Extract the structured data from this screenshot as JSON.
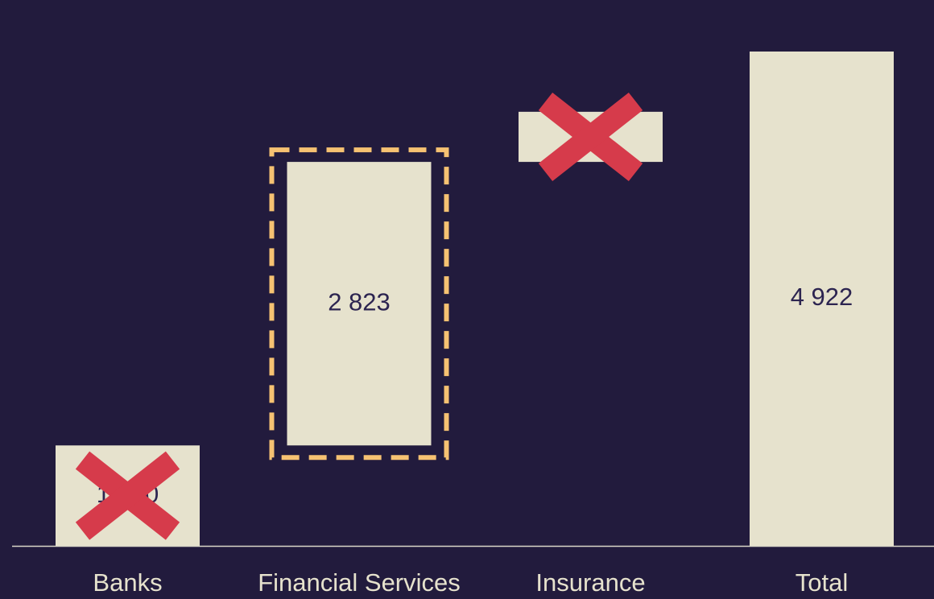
{
  "chart_data": {
    "type": "bar",
    "subtype": "waterfall",
    "title": "",
    "xlabel": "",
    "ylabel": "",
    "categories": [
      "Banks",
      "Financial Services",
      "Insurance",
      "Total"
    ],
    "values": [
      1000,
      2823,
      499,
      4922
    ],
    "value_labels": [
      "1 600",
      "2 823",
      "",
      "4 922"
    ],
    "bar_kind": [
      "delta",
      "delta",
      "delta",
      "total"
    ],
    "ylim": [
      0,
      4922
    ],
    "grid": false,
    "legend": "none",
    "annotations": {
      "highlighted_category": "Financial Services",
      "crossed_out_categories": [
        "Banks",
        "Insurance"
      ]
    }
  },
  "colors": {
    "background": "#221b3d",
    "bar_fill": "#e6e2cd",
    "value_text": "#2c2450",
    "label_text": "#e6e2cd",
    "axis_line": "#d9d6c8",
    "highlight_dash": "#f6c272",
    "cross": "#d63b4b"
  }
}
